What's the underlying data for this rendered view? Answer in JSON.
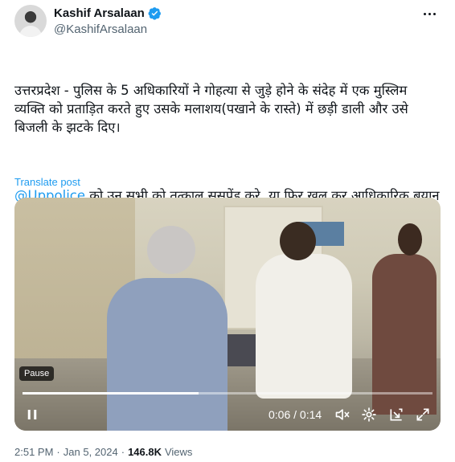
{
  "author": {
    "name": "Kashif Arsalaan",
    "handle": "@KashifArsalaan",
    "verified": true
  },
  "tweet": {
    "paragraph1": "उत्तरप्रदेश - पुलिस के 5 अधिकारियों ने गोहत्या से जुड़े होने के संदेह में एक मुस्लिम व्यक्ति को प्रताड़ित करते हुए उसके मलाशय(पखाने के रास्ते) में छड़ी डाली और उसे बिजली के झटके दिए।",
    "mention": "@Uppolice",
    "paragraph2_rest": " को उन सभी को तत्काल ससपेंड करे, या फिर खुल कर आधिकारिक बयान जारी करें के हम केवल एक समुदाय विशेष को ही सुरक्षा प्रदान करेंगे,मुसलमान अपनी हिफाज़त खुद करें।",
    "translate_label": "Translate post"
  },
  "video": {
    "pause_tooltip": "Pause",
    "current_time": "0:06",
    "duration": "0:14",
    "time_separator": " / ",
    "progress": 0.43
  },
  "meta": {
    "time": "2:51 PM",
    "separator": "·",
    "date": "Jan 5, 2024",
    "views_count": "146.8K",
    "views_label": "Views"
  },
  "colors": {
    "accent": "#1d9bf0",
    "text": "#0f1419",
    "muted": "#536471"
  }
}
